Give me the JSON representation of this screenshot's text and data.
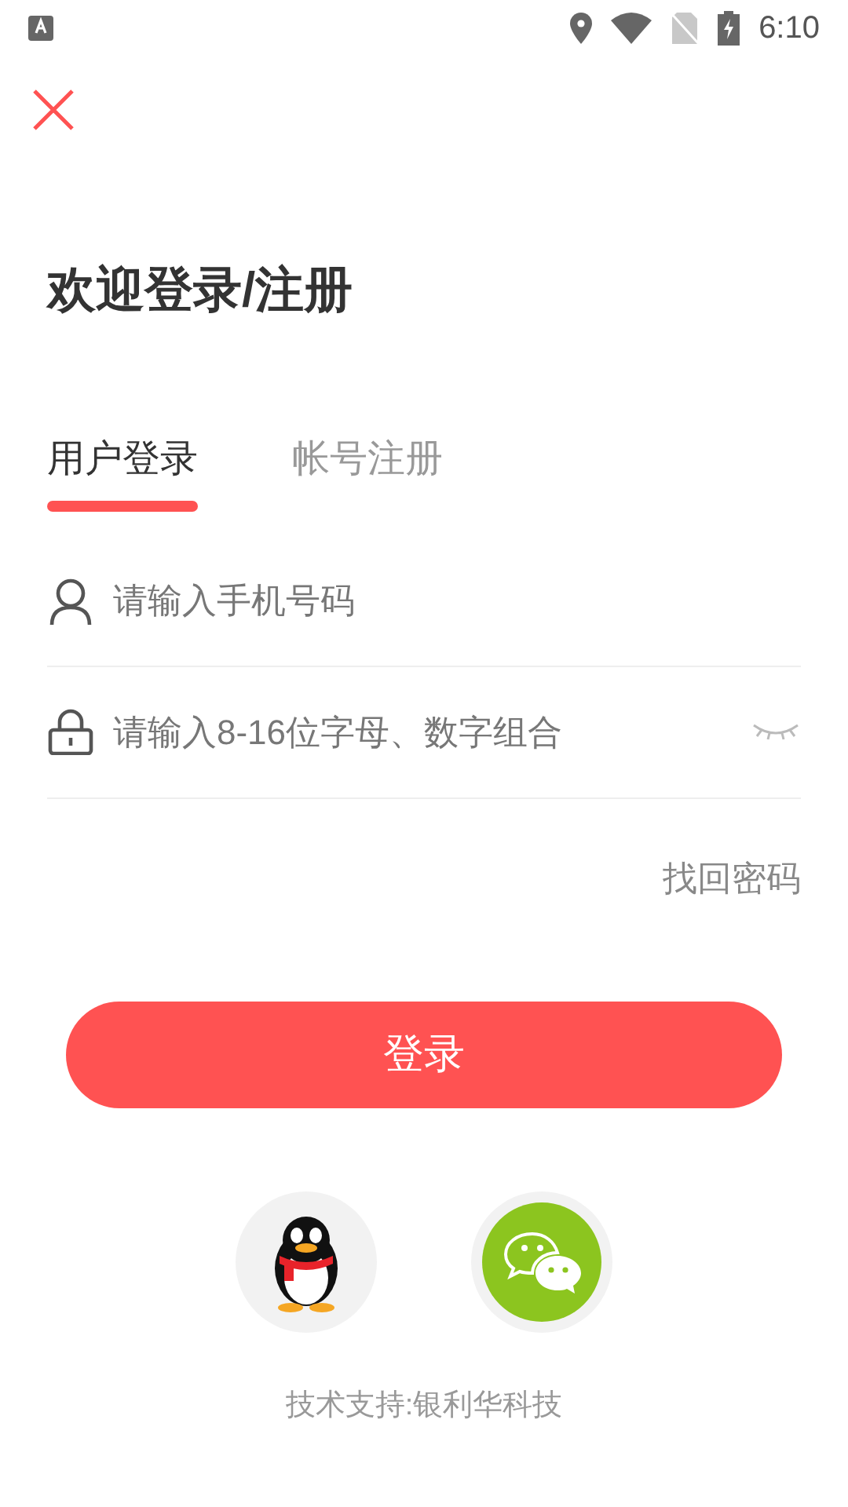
{
  "status_bar": {
    "time": "6:10"
  },
  "title": "欢迎登录/注册",
  "tabs": [
    {
      "label": "用户登录",
      "selected": true
    },
    {
      "label": "帐号注册",
      "selected": false
    }
  ],
  "phone_field": {
    "placeholder": "请输入手机号码"
  },
  "password_field": {
    "placeholder": "请输入8-16位字母、数字组合",
    "visible": false
  },
  "forgot_link": "找回密码",
  "login_button": "登录",
  "social_logins": [
    {
      "kind": "penguin"
    },
    {
      "kind": "chat"
    }
  ],
  "footer": "技术支持:银利华科技"
}
